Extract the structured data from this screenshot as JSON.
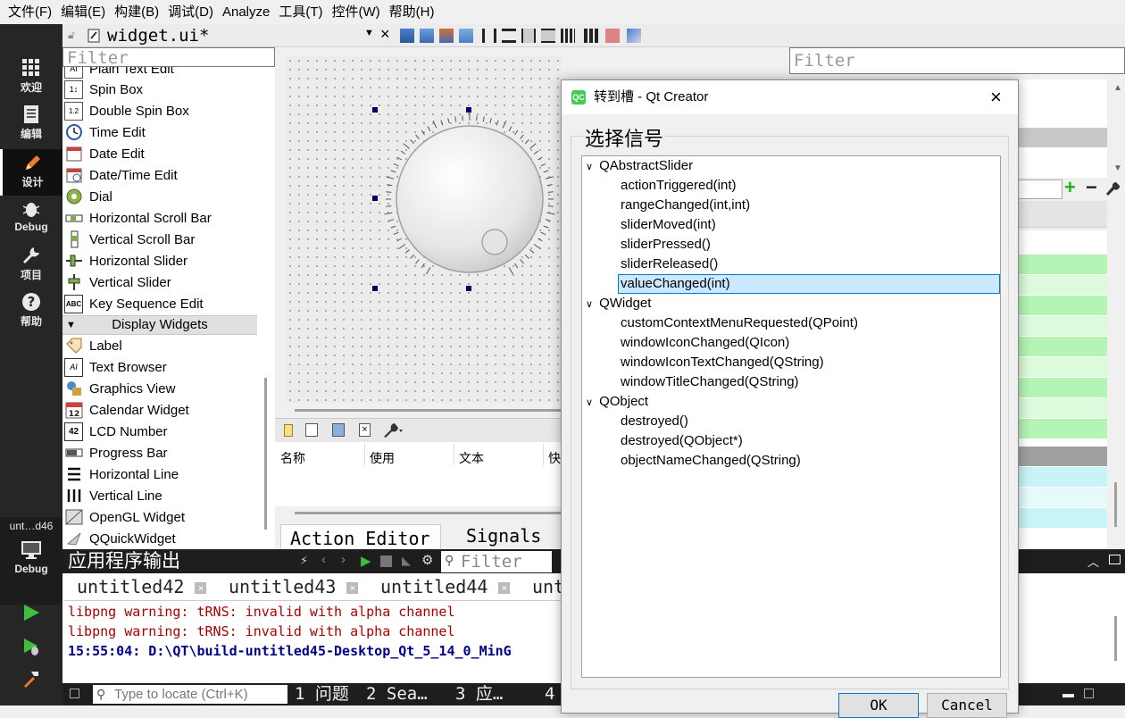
{
  "menubar": {
    "items": [
      "文件(F)",
      "编辑(E)",
      "构建(B)",
      "调试(D)",
      "Analyze",
      "工具(T)",
      "控件(W)",
      "帮助(H)"
    ]
  },
  "modes": [
    {
      "label": "欢迎",
      "icon": "grid-icon"
    },
    {
      "label": "编辑",
      "icon": "document-icon"
    },
    {
      "label": "设计",
      "icon": "pencil-icon"
    },
    {
      "label": "Debug",
      "icon": "bug-icon"
    },
    {
      "label": "项目",
      "icon": "wrench-icon"
    },
    {
      "label": "帮助",
      "icon": "help-icon"
    }
  ],
  "kit": {
    "label": "unt…d46",
    "mode_label": "Debug"
  },
  "editor": {
    "file_tab": "widget.ui*"
  },
  "widgetbox": {
    "filter_placeholder": "Filter",
    "items_input": [
      {
        "label": "Plain Text Edit",
        "icon": "plain-text-edit-icon"
      },
      {
        "label": "Spin Box",
        "icon": "spin-box-icon"
      },
      {
        "label": "Double Spin Box",
        "icon": "double-spin-box-icon"
      },
      {
        "label": "Time Edit",
        "icon": "time-edit-icon"
      },
      {
        "label": "Date Edit",
        "icon": "date-edit-icon"
      },
      {
        "label": "Date/Time Edit",
        "icon": "datetime-edit-icon"
      },
      {
        "label": "Dial",
        "icon": "dial-icon"
      },
      {
        "label": "Horizontal Scroll Bar",
        "icon": "hscrollbar-icon"
      },
      {
        "label": "Vertical Scroll Bar",
        "icon": "vscrollbar-icon"
      },
      {
        "label": "Horizontal Slider",
        "icon": "hslider-icon"
      },
      {
        "label": "Vertical Slider",
        "icon": "vslider-icon"
      },
      {
        "label": "Key Sequence Edit",
        "icon": "key-sequence-icon"
      }
    ],
    "category_display": "Display Widgets",
    "items_display": [
      {
        "label": "Label",
        "icon": "label-icon"
      },
      {
        "label": "Text Browser",
        "icon": "text-browser-icon"
      },
      {
        "label": "Graphics View",
        "icon": "graphics-view-icon"
      },
      {
        "label": "Calendar Widget",
        "icon": "calendar-icon"
      },
      {
        "label": "LCD Number",
        "icon": "lcd-number-icon"
      },
      {
        "label": "Progress Bar",
        "icon": "progress-bar-icon"
      },
      {
        "label": "Horizontal Line",
        "icon": "hline-icon"
      },
      {
        "label": "Vertical Line",
        "icon": "vline-icon"
      },
      {
        "label": "OpenGL Widget",
        "icon": "opengl-icon"
      },
      {
        "label": "QQuickWidget",
        "icon": "qquick-icon"
      }
    ]
  },
  "action_editor": {
    "columns": [
      "名称",
      "使用",
      "文本",
      "快"
    ],
    "tabs": [
      "Action Editor",
      "Signals _"
    ]
  },
  "property_panel": {
    "filter_placeholder": "Filter"
  },
  "output": {
    "title": "应用程序输出",
    "filter_placeholder": "Filter",
    "tabs": [
      "untitled42",
      "untitled43",
      "untitled44",
      "unt"
    ],
    "lines": [
      {
        "text": "libpng warning: tRNS: invalid with alpha channel",
        "color": "#aa0000",
        "bold": false
      },
      {
        "text": "libpng warning: tRNS: invalid with alpha channel",
        "color": "#aa0000",
        "bold": false
      },
      {
        "text": "15:55:04: D:\\QT\\build-untitled45-Desktop_Qt_5_14_0_MinG",
        "color": "#00008b",
        "bold": true
      }
    ]
  },
  "statusbar": {
    "locator_placeholder": "Type to locate (Ctrl+K)",
    "panes": [
      "1 问题",
      "2 Sea…",
      "3 应…",
      "4"
    ]
  },
  "dialog": {
    "title": "转到槽 - Qt Creator",
    "group_label": "选择信号",
    "tree": [
      {
        "name": "QAbstractSlider",
        "children": [
          "actionTriggered(int)",
          "rangeChanged(int,int)",
          "sliderMoved(int)",
          "sliderPressed()",
          "sliderReleased()",
          "valueChanged(int)"
        ]
      },
      {
        "name": "QWidget",
        "children": [
          "customContextMenuRequested(QPoint)",
          "windowIconChanged(QIcon)",
          "windowIconTextChanged(QString)",
          "windowTitleChanged(QString)"
        ]
      },
      {
        "name": "QObject",
        "children": [
          "destroyed()",
          "destroyed(QObject*)",
          "objectNameChanged(QString)"
        ]
      }
    ],
    "selected": "valueChanged(int)",
    "ok_label": "OK",
    "cancel_label": "Cancel"
  },
  "colors": {
    "selection_bg": "#cce8ff",
    "selection_border": "#0078d7",
    "property_green": "#b4f4b4",
    "property_cyan": "#c8f4f8",
    "mode_bar": "#262626"
  }
}
